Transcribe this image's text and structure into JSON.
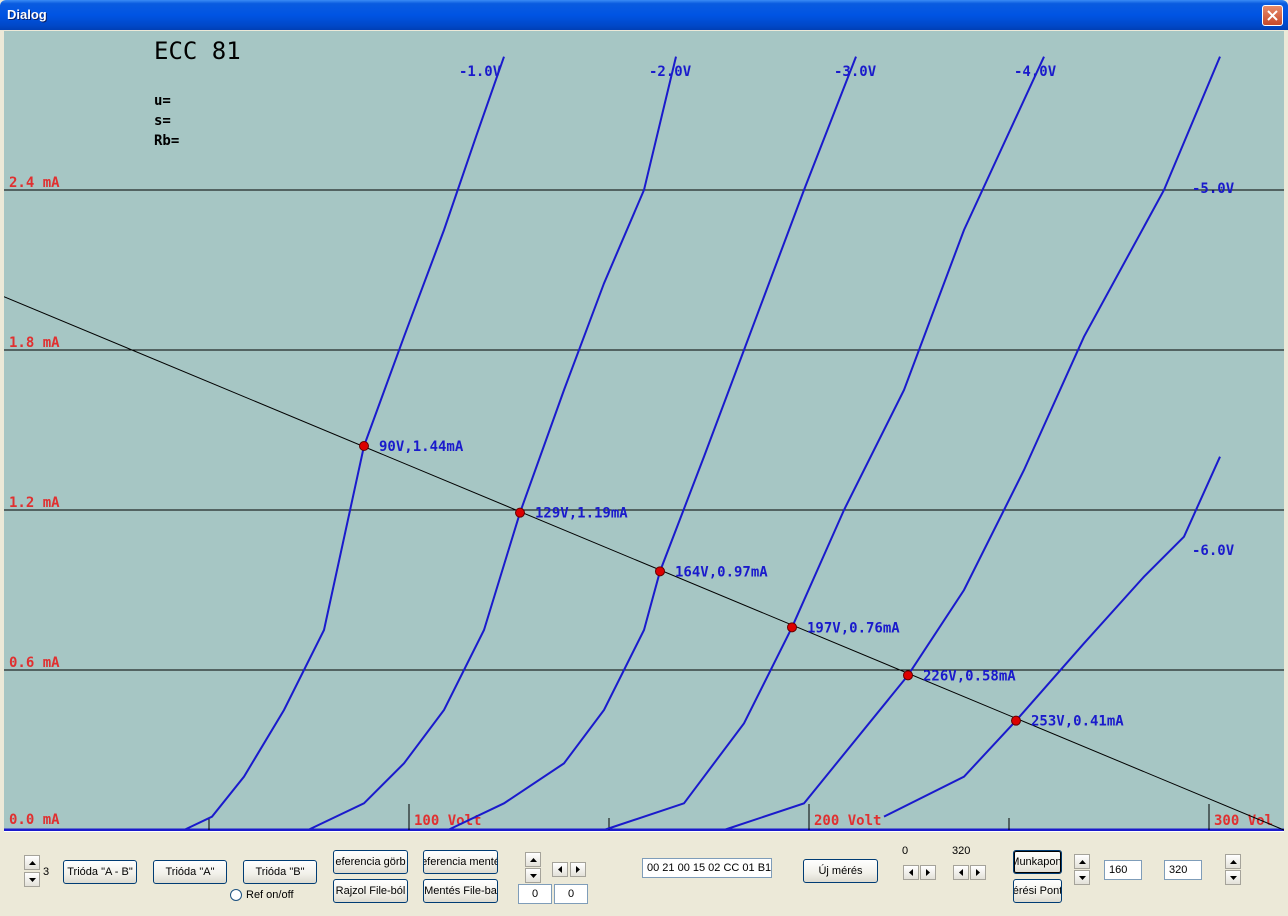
{
  "window": {
    "title": "Dialog"
  },
  "plot": {
    "tube_name": "ECC 81",
    "params": [
      "u=",
      "s=",
      "Rb="
    ],
    "colors": {
      "background": "#a6c6c4",
      "curve": "#1a1acc",
      "axis_label": "#e03030",
      "point": "#dd0000"
    }
  },
  "chart_data": {
    "type": "line",
    "x_axis": {
      "ticks": [
        "100 Volt",
        "200 Volt",
        "300 Vol"
      ],
      "range": [
        0,
        320
      ]
    },
    "y_axis": {
      "ticks": [
        "2.4 mA",
        "1.8 mA",
        "1.2 mA",
        "0.6 mA",
        "0.0 mA"
      ],
      "range": [
        0,
        3.0
      ]
    },
    "series": [
      {
        "name": "-1.0V",
        "points": [
          [
            45,
            0
          ],
          [
            52,
            0.05
          ],
          [
            60,
            0.2
          ],
          [
            70,
            0.45
          ],
          [
            80,
            0.75
          ],
          [
            90,
            1.44
          ],
          [
            100,
            1.85
          ],
          [
            110,
            2.25
          ],
          [
            118,
            2.6
          ],
          [
            125,
            2.9
          ]
        ]
      },
      {
        "name": "-2.0V",
        "points": [
          [
            76,
            0
          ],
          [
            90,
            0.1
          ],
          [
            100,
            0.25
          ],
          [
            110,
            0.45
          ],
          [
            120,
            0.75
          ],
          [
            129,
            1.19
          ],
          [
            140,
            1.65
          ],
          [
            150,
            2.05
          ],
          [
            160,
            2.4
          ],
          [
            168,
            2.9
          ]
        ]
      },
      {
        "name": "-3.0V",
        "points": [
          [
            111,
            0
          ],
          [
            125,
            0.1
          ],
          [
            140,
            0.25
          ],
          [
            150,
            0.45
          ],
          [
            160,
            0.75
          ],
          [
            164,
            0.97
          ],
          [
            175,
            1.4
          ],
          [
            185,
            1.8
          ],
          [
            200,
            2.4
          ],
          [
            213,
            2.9
          ]
        ]
      },
      {
        "name": "-4.0V",
        "points": [
          [
            150,
            0
          ],
          [
            170,
            0.1
          ],
          [
            185,
            0.4
          ],
          [
            197,
            0.76
          ],
          [
            210,
            1.2
          ],
          [
            225,
            1.65
          ],
          [
            240,
            2.25
          ],
          [
            260,
            2.9
          ]
        ]
      },
      {
        "name": "-5.0V",
        "points": [
          [
            180,
            0
          ],
          [
            200,
            0.1
          ],
          [
            226,
            0.58
          ],
          [
            240,
            0.9
          ],
          [
            255,
            1.35
          ],
          [
            270,
            1.85
          ],
          [
            290,
            2.4
          ],
          [
            304,
            2.9
          ]
        ]
      },
      {
        "name": "-6.0V",
        "points": [
          [
            220,
            0.05
          ],
          [
            240,
            0.2
          ],
          [
            253,
            0.41
          ],
          [
            270,
            0.7
          ],
          [
            285,
            0.95
          ],
          [
            295,
            1.1
          ],
          [
            304,
            1.4
          ]
        ]
      }
    ],
    "load_line": [
      [
        0,
        2.0
      ],
      [
        320,
        0
      ]
    ],
    "operating_points": [
      {
        "x": 90,
        "y": 1.44,
        "label": "90V,1.44mA"
      },
      {
        "x": 129,
        "y": 1.19,
        "label": "129V,1.19mA"
      },
      {
        "x": 164,
        "y": 0.97,
        "label": "164V,0.97mA"
      },
      {
        "x": 197,
        "y": 0.76,
        "label": "197V,0.76mA"
      },
      {
        "x": 226,
        "y": 0.58,
        "label": "226V,0.58mA"
      },
      {
        "x": 253,
        "y": 0.41,
        "label": "253V,0.41mA"
      }
    ],
    "grid": true
  },
  "controls": {
    "spin_value": "3",
    "buttons": {
      "trioda_ab": "Trióda \"A - B\"",
      "trioda_a": "Trióda  \"A\"",
      "trioda_b": "Trióda  \"B\"",
      "ref_curve": "eferencia görb",
      "ref_save": "eferencia menté",
      "draw_from_file": "Rajzol File-ból",
      "save_to_file": "Mentés File-ba",
      "new_measure": "Új mérés",
      "workpoint": "Munkapont",
      "measure_point": "érési Pont"
    },
    "ref_toggle": "Ref on/off",
    "offset_a": "0",
    "offset_b": "0",
    "hex_field": "00 21 00 15 02 CC 01 B1",
    "range_min_label": "0",
    "range_max_label": "320",
    "field_160": "160",
    "field_320": "320"
  }
}
